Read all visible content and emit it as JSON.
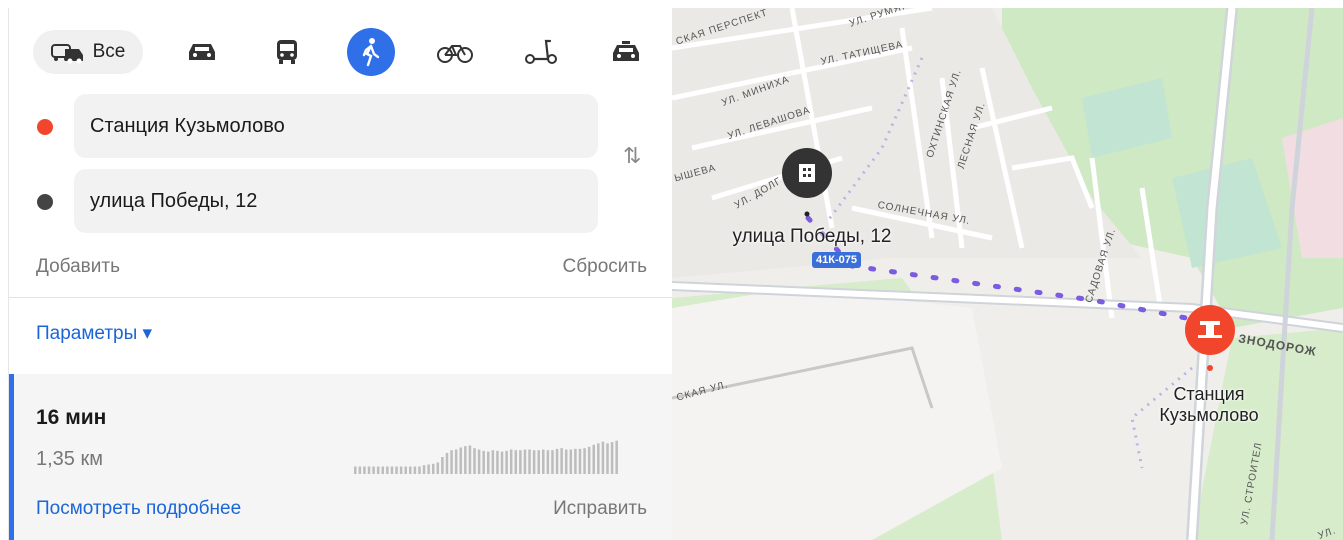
{
  "transport_modes": {
    "all_label": "Все",
    "items": [
      {
        "name": "all-mode-icon"
      },
      {
        "name": "car-icon"
      },
      {
        "name": "bus-icon"
      },
      {
        "name": "walk-icon",
        "active": true
      },
      {
        "name": "bicycle-icon"
      },
      {
        "name": "scooter-icon"
      },
      {
        "name": "taxi-icon"
      }
    ]
  },
  "route": {
    "from": "Станция Кузьмолово",
    "to": "улица Победы, 12",
    "from_color": "#f2462c",
    "to_color": "#444444",
    "add_label": "Добавить",
    "reset_label": "Сбросить"
  },
  "params_label": "Параметры ▾",
  "result": {
    "time": "16 мин",
    "distance": "1,35 км",
    "details_label": "Посмотреть подробнее",
    "fix_label": "Исправить",
    "elevation": [
      0.22,
      0.22,
      0.22,
      0.22,
      0.22,
      0.22,
      0.22,
      0.22,
      0.22,
      0.22,
      0.22,
      0.22,
      0.22,
      0.22,
      0.22,
      0.26,
      0.28,
      0.3,
      0.34,
      0.5,
      0.62,
      0.7,
      0.72,
      0.78,
      0.82,
      0.84,
      0.76,
      0.72,
      0.68,
      0.66,
      0.7,
      0.68,
      0.66,
      0.68,
      0.72,
      0.7,
      0.7,
      0.72,
      0.72,
      0.7,
      0.7,
      0.72,
      0.7,
      0.7,
      0.74,
      0.76,
      0.72,
      0.72,
      0.74,
      0.74,
      0.76,
      0.8,
      0.86,
      0.9,
      0.95,
      0.9,
      0.94,
      0.98
    ]
  },
  "map": {
    "pin_destination_label": "улица Победы, 12",
    "pin_station_label": "Станция\nКузьмолово",
    "road_badge": "41К-075",
    "streets": [
      "ул. Румяна",
      "ская перспект",
      "ул. Татищева",
      "ул. Миниха",
      "ул. Левашова",
      "ул. Долг",
      "ышева",
      "Охтинская ул.",
      "Лесная ул.",
      "Солнечная ул.",
      "Садовая ул.",
      "знодорож",
      "ская ул.",
      "ул. Строител",
      "ул."
    ],
    "accent": "#2f6fe8",
    "station_color": "#f2462c"
  }
}
